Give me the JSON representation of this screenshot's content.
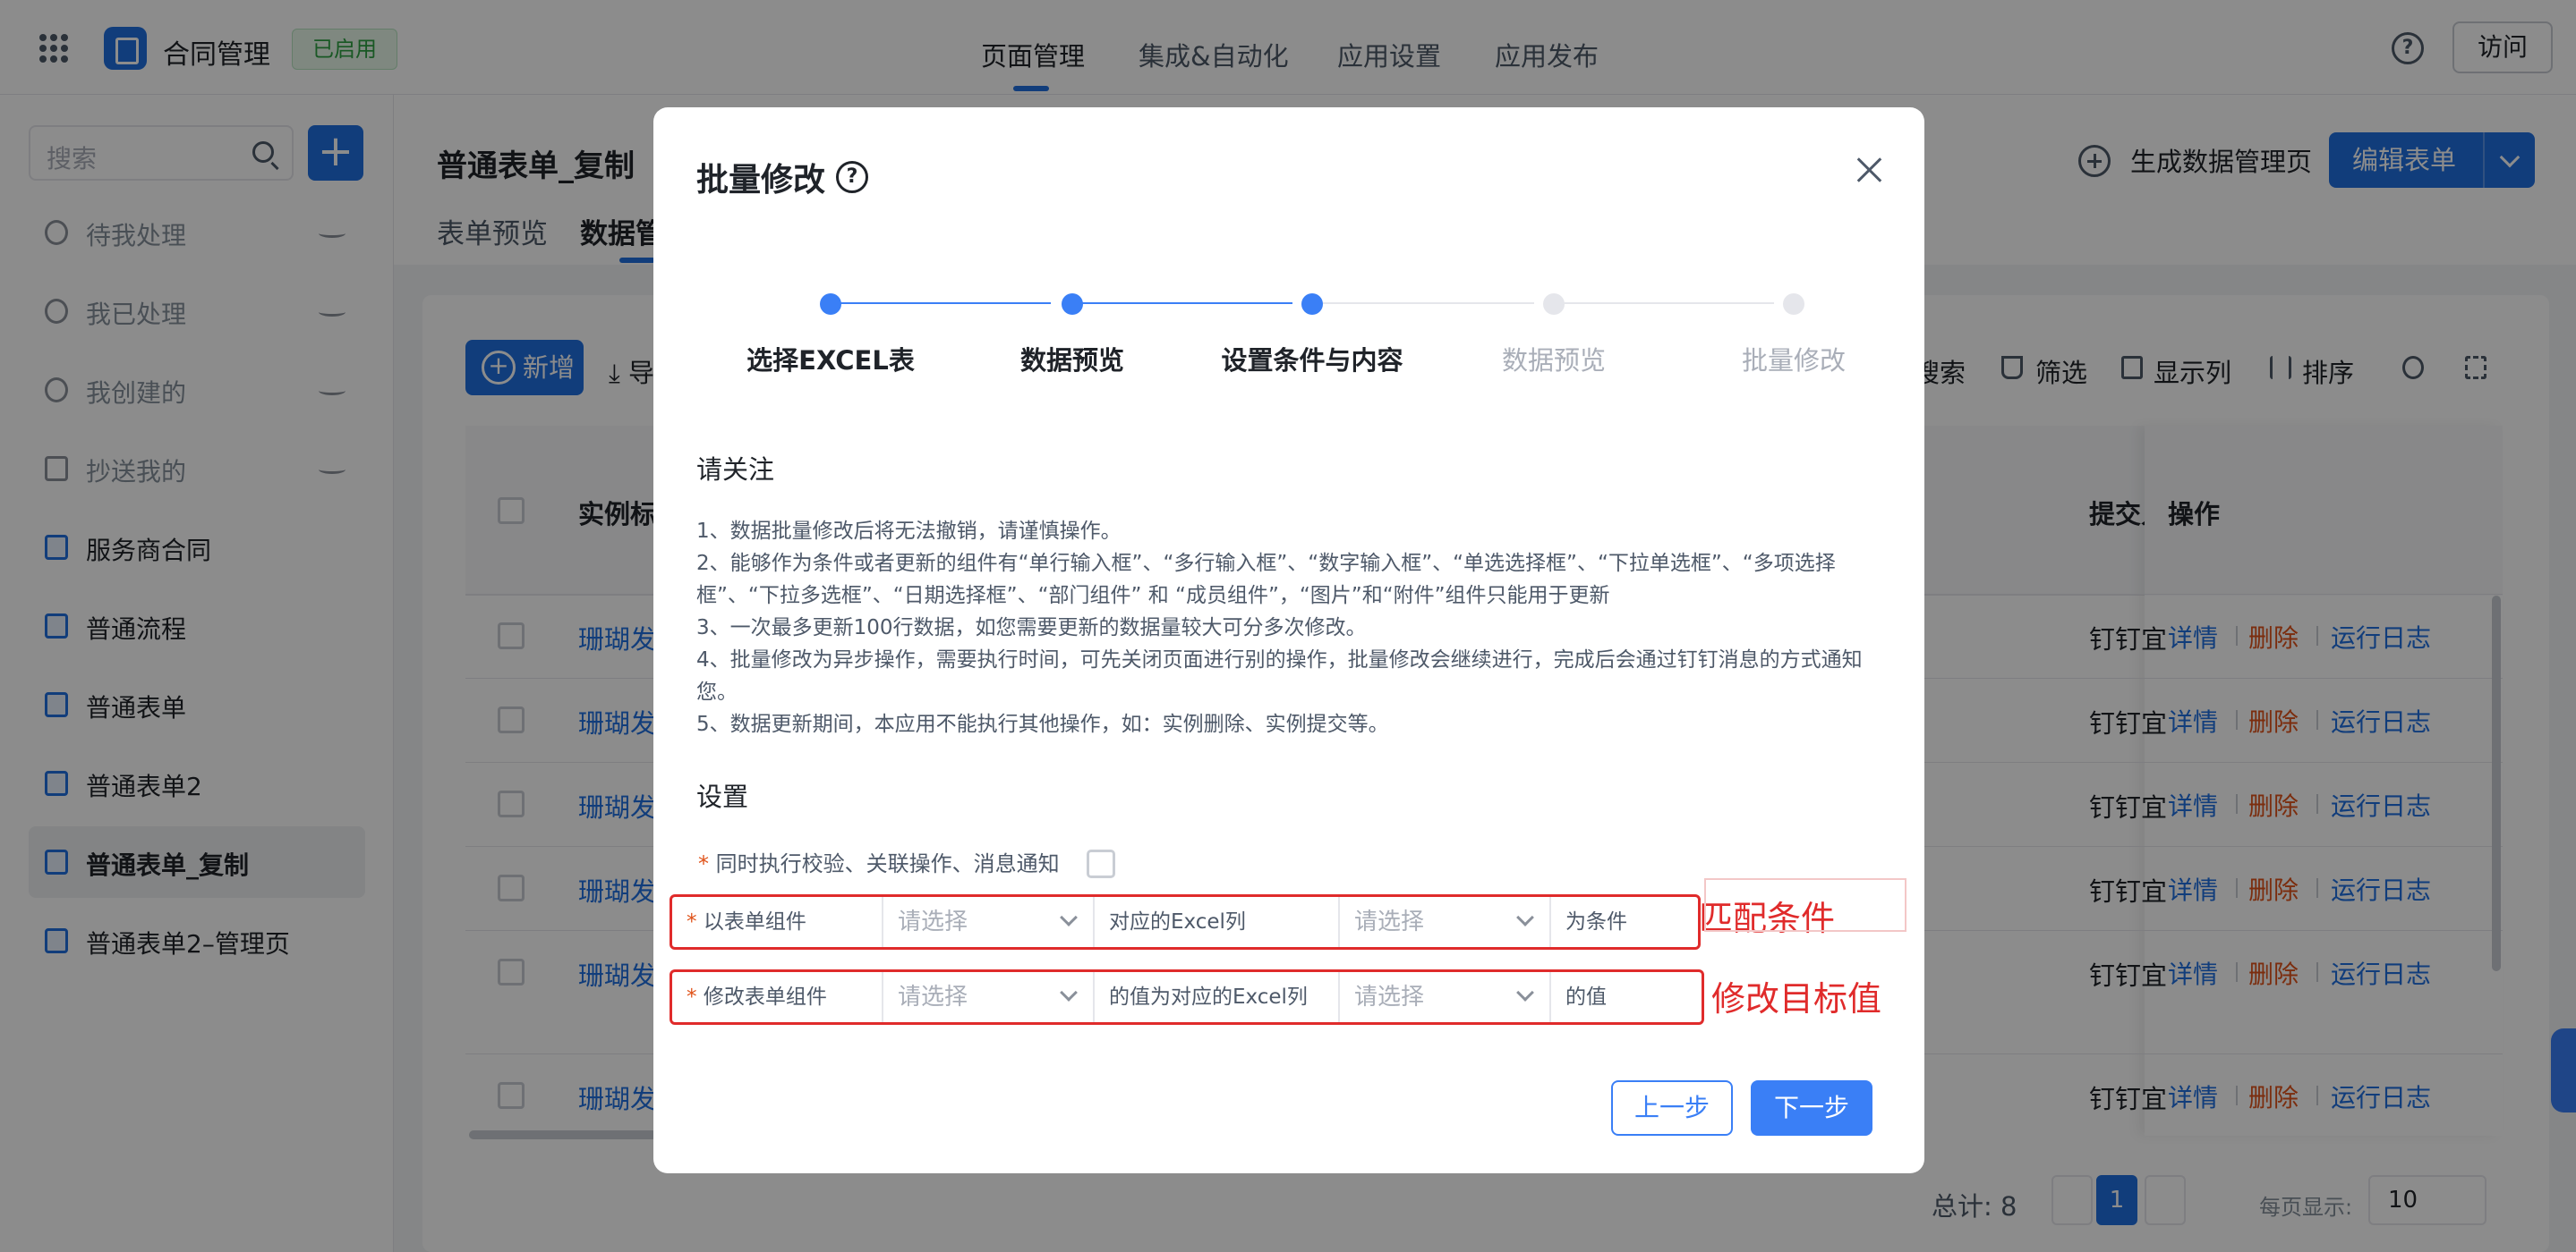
{
  "topbar": {
    "app_name": "合同管理",
    "status_badge": "已启用",
    "nav": [
      "页面管理",
      "集成&自动化",
      "应用设置",
      "应用发布"
    ],
    "help": "?",
    "visit": "访问"
  },
  "sidebar": {
    "search_placeholder": "搜索",
    "add": "+",
    "items": [
      {
        "label": "待我处理"
      },
      {
        "label": "我已处理"
      },
      {
        "label": "我创建的"
      },
      {
        "label": "抄送我的"
      },
      {
        "label": "服务商合同"
      },
      {
        "label": "普通流程"
      },
      {
        "label": "普通表单"
      },
      {
        "label": "普通表单2"
      },
      {
        "label": "普通表单_复制"
      },
      {
        "label": "普通表单2–管理页"
      }
    ]
  },
  "main": {
    "title": "普通表单_复制",
    "tabs": [
      "表单预览",
      "数据管"
    ],
    "generate": "生成数据管理页",
    "edit": "编辑表单",
    "toolbar": {
      "new": "新增",
      "export": "导",
      "search": "搜索",
      "filter": "筛选",
      "columns": "显示列",
      "sort": "排序"
    },
    "table": {
      "headers": [
        "实例标",
        "提交人",
        "操作"
      ],
      "rows": [
        {
          "title": "珊瑚发",
          "submitter": "钉钉宜"
        },
        {
          "title": "珊瑚发",
          "submitter": "钉钉宜"
        },
        {
          "title": "珊瑚发",
          "submitter": "钉钉宜"
        },
        {
          "title": "珊瑚发",
          "submitter": "钉钉宜"
        },
        {
          "title": "珊瑚发",
          "submitter": "钉钉宜"
        },
        {
          "title": "珊瑚发",
          "submitter": "钉钉宜"
        }
      ],
      "ops": {
        "detail": "详情",
        "delete": "删除",
        "log": "运行日志"
      }
    },
    "pagination": {
      "total": "总计: 8",
      "current": "1",
      "per_page_label": "每页显示:",
      "per_page": "10"
    }
  },
  "modal": {
    "title": "批量修改",
    "help": "?",
    "steps": [
      {
        "label": "选择EXCEL表",
        "state": "done"
      },
      {
        "label": "数据预览",
        "state": "done"
      },
      {
        "label": "设置条件与内容",
        "state": "current"
      },
      {
        "label": "数据预览",
        "state": "todo"
      },
      {
        "label": "批量修改",
        "state": "todo"
      }
    ],
    "notice_title": "请关注",
    "notice": [
      "1、数据批量修改后将无法撤销，请谨慎操作。",
      "2、能够作为条件或者更新的组件有“单行输入框”、“多行输入框”、“数字输入框”、“单选选择框”、“下拉单选框”、“多项选择框”、“下拉多选框”、“日期选择框”、“部门组件” 和 “成员组件”，“图片”和“附件”组件只能用于更新",
      "3、一次最多更新100行数据，如您需要更新的数据量较大可分多次修改。",
      "4、批量修改为异步操作，需要执行时间，可先关闭页面进行别的操作，批量修改会继续进行，完成后会通过钉钉消息的方式通知您。",
      "5、数据更新期间，本应用不能执行其他操作，如：实例删除、实例提交等。"
    ],
    "settings_title": "设置",
    "option_label": "同时执行校验、关联操作、消息通知",
    "condition_row": {
      "label": "以表单组件",
      "select1": "请选择",
      "middle": "对应的Excel列",
      "select2": "请选择",
      "suffix": "为条件"
    },
    "update_row": {
      "label": "修改表单组件",
      "select1": "请选择",
      "middle": "的值为对应的Excel列",
      "select2": "请选择",
      "suffix": "的值"
    },
    "annotation_match": "匹配条件",
    "annotation_target": "修改目标值",
    "prev": "上一步",
    "next": "下一步"
  },
  "colors": {
    "primary": "#1f6fe0",
    "step_active": "#3a7ff6",
    "danger": "#e0531a",
    "annotation": "#e02b2b"
  }
}
